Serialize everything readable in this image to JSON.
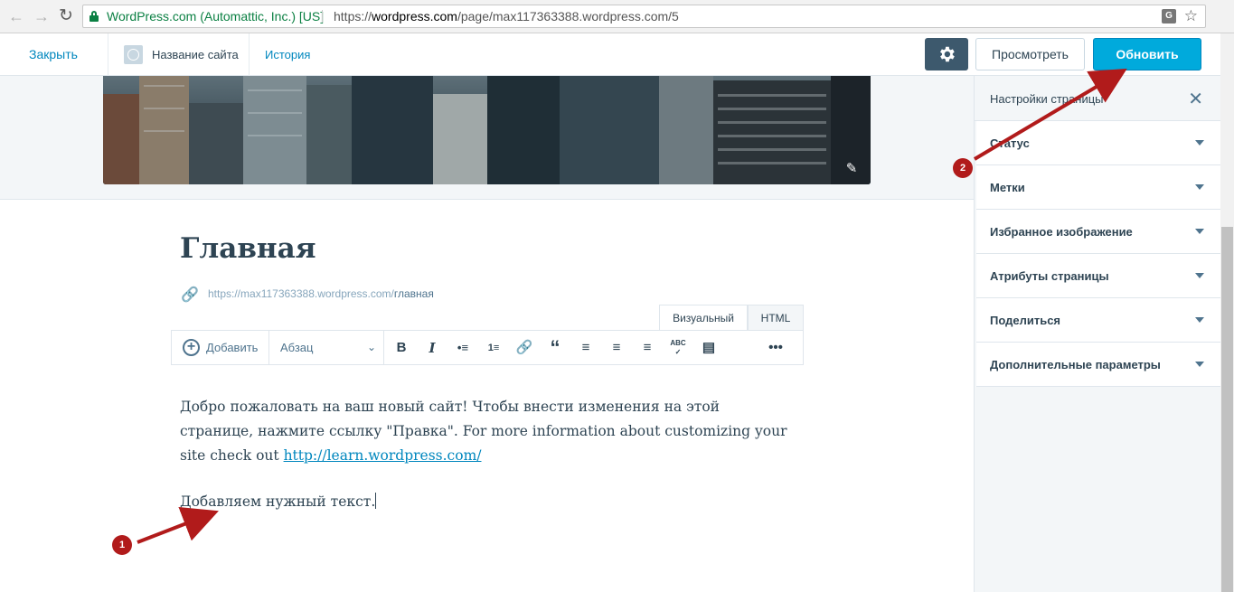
{
  "browser": {
    "cert_label": "WordPress.com (Automattic, Inc.) [US]",
    "url_scheme": "https://",
    "url_host": "wordpress.com",
    "url_path": "/page/max117363388.wordpress.com/5"
  },
  "masterbar": {
    "close_label": "Закрыть",
    "site_title": "Название сайта",
    "history_label": "История",
    "preview_label": "Просмотреть",
    "update_label": "Обновить"
  },
  "editor": {
    "page_title": "Главная",
    "permalink_base": "https://max117363388.wordpress.com/",
    "permalink_slug": "главная",
    "tab_visual": "Визуальный",
    "tab_html": "HTML",
    "add_label": "Добавить",
    "format_label": "Абзац",
    "content_p1_text": "Добро пожаловать на ваш новый сайт! Чтобы внести изменения на этой странице, нажмите ссылку \"Правка\". For more information about customizing your site check out ",
    "content_p1_link": "http://learn.wordpress.com/",
    "content_p2": "Добавляем нужный текст."
  },
  "sidebar": {
    "title": "Настройки страницы",
    "items": [
      {
        "label": "Статус"
      },
      {
        "label": "Метки"
      },
      {
        "label": "Избранное изображение"
      },
      {
        "label": "Атрибуты страницы"
      },
      {
        "label": "Поделиться"
      },
      {
        "label": "Дополнительные параметры"
      }
    ]
  },
  "annotations": {
    "step1": "1",
    "step2": "2",
    "color": "#b11b1b"
  },
  "colors": {
    "accent": "#00aadc",
    "link": "#0087be",
    "dark": "#2e4453"
  }
}
